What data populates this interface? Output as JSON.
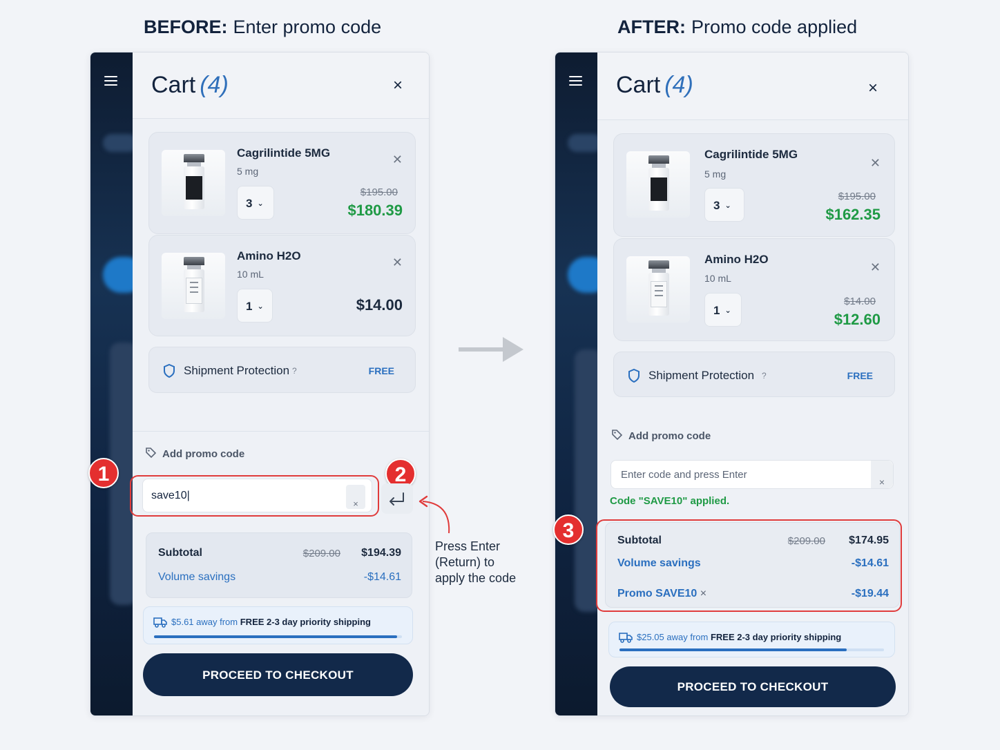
{
  "headings": {
    "before_prefix": "BEFORE:",
    "before_text": "Enter promo code",
    "after_prefix": "AFTER:",
    "after_text": "Promo code applied"
  },
  "colors": {
    "navy": "#12294a",
    "accent_blue": "#2a6fbf",
    "price_green": "#1f9a45",
    "annotation_red": "#e42f2f"
  },
  "before": {
    "cart_title": "Cart",
    "cart_count": "(4)",
    "close_glyph": "×",
    "items": [
      {
        "name": "Cagrilintide 5MG",
        "size": "5 mg",
        "qty": "3",
        "old_price": "$195.00",
        "price": "$180.39",
        "image_icon": "vial-dark-label"
      },
      {
        "name": "Amino H2O",
        "size": "10 mL",
        "qty": "1",
        "price": "$14.00",
        "image_icon": "vial-light-label"
      }
    ],
    "shipment": {
      "label": "Shipment Protection",
      "help": "?",
      "value": "FREE",
      "icon": "shield-icon"
    },
    "promo": {
      "label": "Add promo code",
      "input_value": "save10",
      "clear": "×",
      "icon": "tag-icon"
    },
    "totals": {
      "subtotal_label": "Subtotal",
      "subtotal_old": "$209.00",
      "subtotal": "$194.39",
      "savings_label": "Volume savings",
      "savings": "-$14.61"
    },
    "shipping_bar": {
      "away": "$5.61 away from",
      "goal": "FREE 2-3 day priority shipping",
      "progress": 0.98
    },
    "checkout": "PROCEED TO CHECKOUT"
  },
  "after": {
    "cart_title": "Cart",
    "cart_count": "(4)",
    "close_glyph": "×",
    "items": [
      {
        "name": "Cagrilintide 5MG",
        "size": "5 mg",
        "qty": "3",
        "old_price": "$195.00",
        "price": "$162.35",
        "image_icon": "vial-dark-label"
      },
      {
        "name": "Amino H2O",
        "size": "10 mL",
        "qty": "1",
        "old_price": "$14.00",
        "price": "$12.60",
        "image_icon": "vial-light-label"
      }
    ],
    "shipment": {
      "label": "Shipment Protection",
      "help": "?",
      "value": "FREE",
      "icon": "shield-icon"
    },
    "promo": {
      "label": "Add promo code",
      "placeholder": "Enter code and press Enter",
      "clear": "×",
      "applied_msg": "Code \"SAVE10\" applied.",
      "icon": "tag-icon"
    },
    "totals": {
      "subtotal_label": "Subtotal",
      "subtotal_old": "$209.00",
      "subtotal": "$174.95",
      "savings_label": "Volume savings",
      "savings": "-$14.61",
      "promo_label": "Promo SAVE10",
      "promo_remove": "×",
      "promo_value": "-$19.44"
    },
    "shipping_bar": {
      "away": "$25.05 away from",
      "goal": "FREE 2-3 day priority shipping",
      "progress": 0.86
    },
    "checkout": "PROCEED TO CHECKOUT"
  },
  "annotations": {
    "step1": "1",
    "step2": "2",
    "step3": "3",
    "note_line1": "Press Enter",
    "note_line2": "(Return) to",
    "note_line3": "apply the code",
    "enter_icon": "return-key-icon",
    "arrow_icon": "right-arrow-icon"
  }
}
